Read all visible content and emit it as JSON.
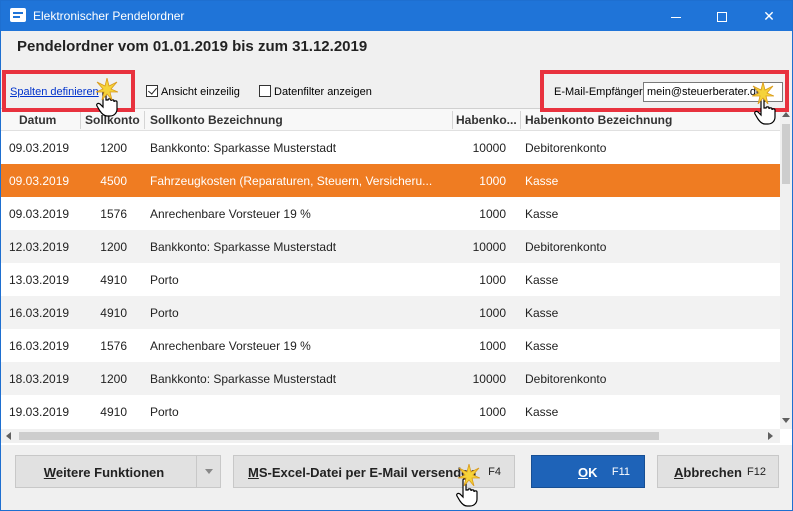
{
  "window": {
    "title": "Elektronischer Pendelordner"
  },
  "heading": "Pendelordner vom 01.01.2019 bis zum 31.12.2019",
  "toolbar": {
    "define_columns_link": "Spalten definieren",
    "single_line_label": "Ansicht einzeilig",
    "single_line_checked": true,
    "data_filter_label": "Datenfilter anzeigen",
    "data_filter_checked": false,
    "email_label": "E-Mail-Empfänger:",
    "email_value": "mein@steuerberater.de"
  },
  "table": {
    "columns": [
      "Datum",
      "Sollkonto",
      "Sollkonto Bezeichnung",
      "Habenkonto",
      "Habenkonto Bezeichnung"
    ],
    "column_labels_shown": [
      "Datum",
      "Sollkonto",
      "Sollkonto Bezeichnung",
      "Habenko...",
      "Habenkonto Bezeichnung"
    ],
    "rows": [
      {
        "datum": "09.03.2019",
        "soll": "1200",
        "soll_bez": "Bankkonto: Sparkasse Musterstadt",
        "haben": "10000",
        "haben_bez": "Debitorenkonto"
      },
      {
        "datum": "09.03.2019",
        "soll": "4500",
        "soll_bez": "Fahrzeugkosten (Reparaturen, Steuern, Versicheru...",
        "haben": "1000",
        "haben_bez": "Kasse",
        "selected": true
      },
      {
        "datum": "09.03.2019",
        "soll": "1576",
        "soll_bez": "Anrechenbare Vorsteuer 19 %",
        "haben": "1000",
        "haben_bez": "Kasse"
      },
      {
        "datum": "12.03.2019",
        "soll": "1200",
        "soll_bez": "Bankkonto: Sparkasse Musterstadt",
        "haben": "10000",
        "haben_bez": "Debitorenkonto"
      },
      {
        "datum": "13.03.2019",
        "soll": "4910",
        "soll_bez": "Porto",
        "haben": "1000",
        "haben_bez": "Kasse"
      },
      {
        "datum": "16.03.2019",
        "soll": "4910",
        "soll_bez": "Porto",
        "haben": "1000",
        "haben_bez": "Kasse"
      },
      {
        "datum": "16.03.2019",
        "soll": "1576",
        "soll_bez": "Anrechenbare Vorsteuer 19 %",
        "haben": "1000",
        "haben_bez": "Kasse"
      },
      {
        "datum": "18.03.2019",
        "soll": "1200",
        "soll_bez": "Bankkonto: Sparkasse Musterstadt",
        "haben": "10000",
        "haben_bez": "Debitorenkonto"
      },
      {
        "datum": "19.03.2019",
        "soll": "4910",
        "soll_bez": "Porto",
        "haben": "1000",
        "haben_bez": "Kasse"
      }
    ]
  },
  "buttons": {
    "weitere_first": "W",
    "weitere_rest": "eitere Funktionen",
    "excel_first": "M",
    "excel_rest": "S-Excel-Datei per E-Mail versenden",
    "excel_key": "F4",
    "ok_first": "O",
    "ok_rest": "K",
    "ok_key": "F11",
    "abbr_first": "A",
    "abbr_rest": "bbrechen",
    "abbr_key": "F12"
  },
  "colors": {
    "titlebar": "#1f74d8",
    "selected_row": "#ef7c22",
    "highlight_box": "#e8323e",
    "ok_button": "#1e63b8"
  }
}
